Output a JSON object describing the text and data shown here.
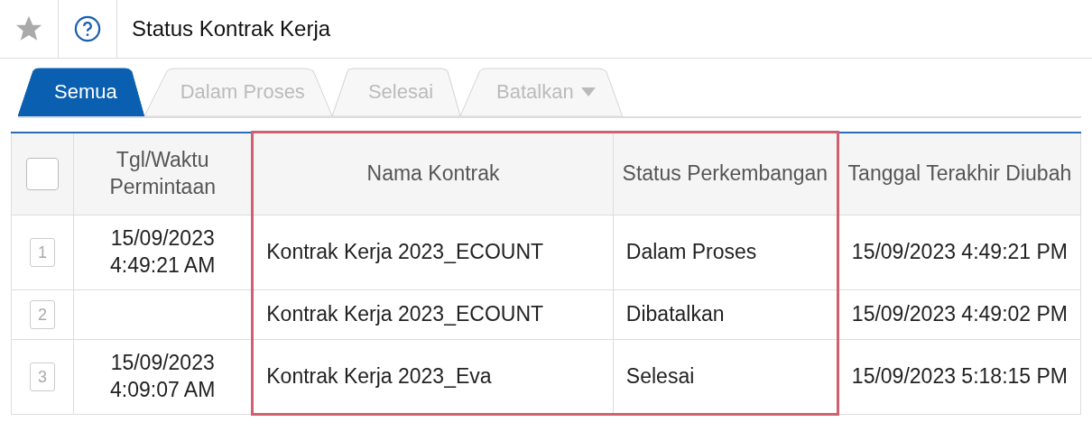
{
  "header": {
    "starred": false,
    "title": "Status Kontrak Kerja"
  },
  "tabs": [
    {
      "label": "Semua",
      "selected": true,
      "dropdown": false
    },
    {
      "label": "Dalam Proses",
      "selected": false,
      "dropdown": false
    },
    {
      "label": "Selesai",
      "selected": false,
      "dropdown": false
    },
    {
      "label": "Batalkan",
      "selected": false,
      "dropdown": true
    }
  ],
  "table": {
    "select_all_checked": false,
    "columns": [
      {
        "label": "Tgl/Waktu Permintaan",
        "highlighted": false
      },
      {
        "label": "Nama Kontrak",
        "highlighted": true
      },
      {
        "label": "Status Perkembangan",
        "highlighted": true
      },
      {
        "label": "Tanggal Terakhir Diubah",
        "highlighted": false
      }
    ],
    "rows": [
      {
        "number": "1",
        "cells": [
          "15/09/2023 4:49:21 AM",
          "Kontrak Kerja 2023_ECOUNT",
          "Dalam Proses",
          "15/09/2023 4:49:21 PM"
        ]
      },
      {
        "number": "2",
        "cells": [
          "",
          "Kontrak Kerja 2023_ECOUNT",
          "Dibatalkan",
          "15/09/2023 4:49:02 PM"
        ]
      },
      {
        "number": "3",
        "cells": [
          "15/09/2023 4:09:07 AM",
          "Kontrak Kerja 2023_Eva",
          "Selesai",
          "15/09/2023 5:18:15 PM"
        ]
      }
    ]
  }
}
